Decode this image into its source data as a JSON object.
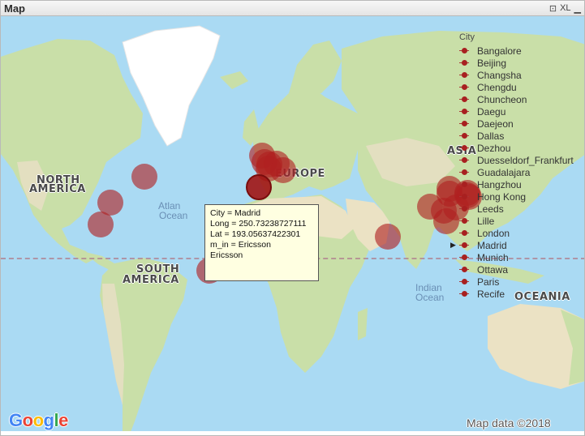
{
  "window": {
    "title": "Map",
    "controls": {
      "pin": "⊡",
      "xl": "XL",
      "minimize": "▁"
    }
  },
  "map_labels": {
    "north_america_1": "NORTH",
    "north_america_2": "AMERICA",
    "south_america_1": "SOUTH",
    "south_america_2": "AMERICA",
    "europe": "EUROPE",
    "asia": "ASIA",
    "oceania": "OCEANIA",
    "atlantic_1": "Atlan",
    "atlantic_2": "Ocean",
    "indian_1": "Indian",
    "indian_2": "Ocean"
  },
  "legend": {
    "title": "City",
    "selected": "Madrid",
    "items": [
      "Bangalore",
      "Beijing",
      "Changsha",
      "Chengdu",
      "Chuncheon",
      "Daegu",
      "Daejeon",
      "Dallas",
      "Dezhou",
      "Duesseldorf_Frankfurt",
      "Guadalajara",
      "Hangzhou",
      "Hong Kong",
      "Leeds",
      "Lille",
      "London",
      "Madrid",
      "Munich",
      "Ottawa",
      "Paris",
      "Recife"
    ],
    "color": "#a82020"
  },
  "tooltip": {
    "city": "City = Madrid",
    "long": "Long = 250.73238727111",
    "lat": "Lat = 193.05637422301",
    "m_in": "m_in = Ericsson",
    "value": "Ericsson"
  },
  "bubbles": [
    {
      "city": "Ottawa",
      "lon": -75.7,
      "lat": 45.4
    },
    {
      "city": "Dallas",
      "lon": -96.8,
      "lat": 32.8
    },
    {
      "city": "Guadalajara",
      "lon": -103.3,
      "lat": 20.7
    },
    {
      "city": "Recife",
      "lon": -34.9,
      "lat": -8.0
    },
    {
      "city": "London",
      "lon": -0.1,
      "lat": 51.5
    },
    {
      "city": "Leeds",
      "lon": -1.5,
      "lat": 53.8
    },
    {
      "city": "Paris",
      "lon": 2.35,
      "lat": 48.9
    },
    {
      "city": "Lille",
      "lon": 3.1,
      "lat": 50.6
    },
    {
      "city": "Duesseldorf_Frankfurt",
      "lon": 7.5,
      "lat": 50.7
    },
    {
      "city": "Munich",
      "lon": 11.6,
      "lat": 48.1
    },
    {
      "city": "Madrid",
      "lon": -3.7,
      "lat": 40.4
    },
    {
      "city": "Bangalore",
      "lon": 77.6,
      "lat": 12.9
    },
    {
      "city": "Chengdu",
      "lon": 104.1,
      "lat": 30.7
    },
    {
      "city": "Changsha",
      "lon": 113.0,
      "lat": 28.2
    },
    {
      "city": "Hangzhou",
      "lon": 120.2,
      "lat": 30.3
    },
    {
      "city": "Hong Kong",
      "lon": 114.2,
      "lat": 22.3
    },
    {
      "city": "Beijing",
      "lon": 116.4,
      "lat": 39.9
    },
    {
      "city": "Dezhou",
      "lon": 116.3,
      "lat": 37.4
    },
    {
      "city": "Daejeon",
      "lon": 127.4,
      "lat": 36.4
    },
    {
      "city": "Daegu",
      "lon": 128.6,
      "lat": 35.9
    },
    {
      "city": "Chuncheon",
      "lon": 127.7,
      "lat": 37.9
    }
  ],
  "attribution": {
    "google": "Google",
    "mapdata": "Map data ©2018"
  },
  "colors": {
    "water": "#aadaf3",
    "land": "#c9dfa8",
    "desert": "#ebe2c4",
    "ice": "#ffffff",
    "bubble": "#b02020"
  }
}
